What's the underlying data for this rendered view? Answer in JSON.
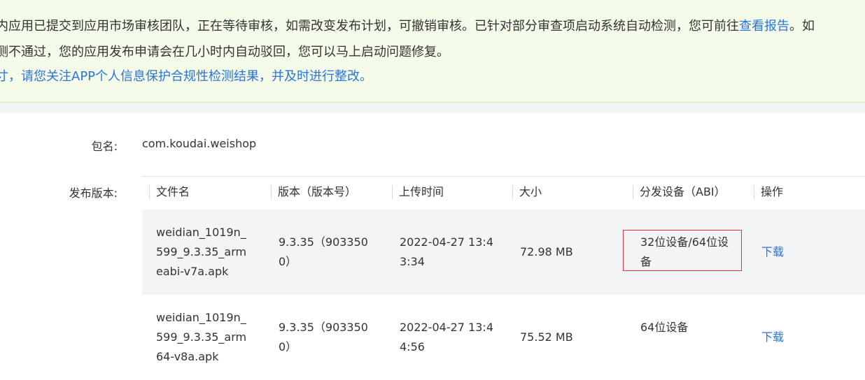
{
  "notice": {
    "line1_text": "内应用已提交到应用市场审核团队，正在等待审核，如需改变发布计划，可撤销审核。已针对部分审查项启动系统自动检测，您可前往",
    "line1_link": "查看报告",
    "line1_tail": "。如",
    "line2_text": "测不通过，您的应用发布申请会在几小时内自动驳回，您可以马上启动问题修复。",
    "line3_text": "寸，请您关注APP个人信息保护合规性检测结果，并及时进行整改。"
  },
  "package": {
    "label": "包名:",
    "value": "com.koudai.weishop"
  },
  "release": {
    "label": "发布版本:",
    "columns": [
      "文件名",
      "版本（版本号）",
      "上传时间",
      "大小",
      "分发设备（ABI）",
      "操作"
    ],
    "rows": [
      {
        "file": "weidian_1019n_599_9.3.35_armeabi-v7a.apk",
        "version": "9.3.35（9033500）",
        "time": "2022-04-27 13:43:34",
        "size": "72.98 MB",
        "abi": "32位设备/64位设备",
        "action": "下载"
      },
      {
        "file": "weidian_1019n_599_9.3.35_arm64-v8a.apk",
        "version": "9.3.35（9033500）",
        "time": "2022-04-27 13:44:56",
        "size": "75.52 MB",
        "abi": "64位设备",
        "action": "下载"
      }
    ]
  },
  "colors": {
    "notice_bg": "#f4fbe9",
    "link": "#2b74d8",
    "highlight": "#d9343a"
  }
}
